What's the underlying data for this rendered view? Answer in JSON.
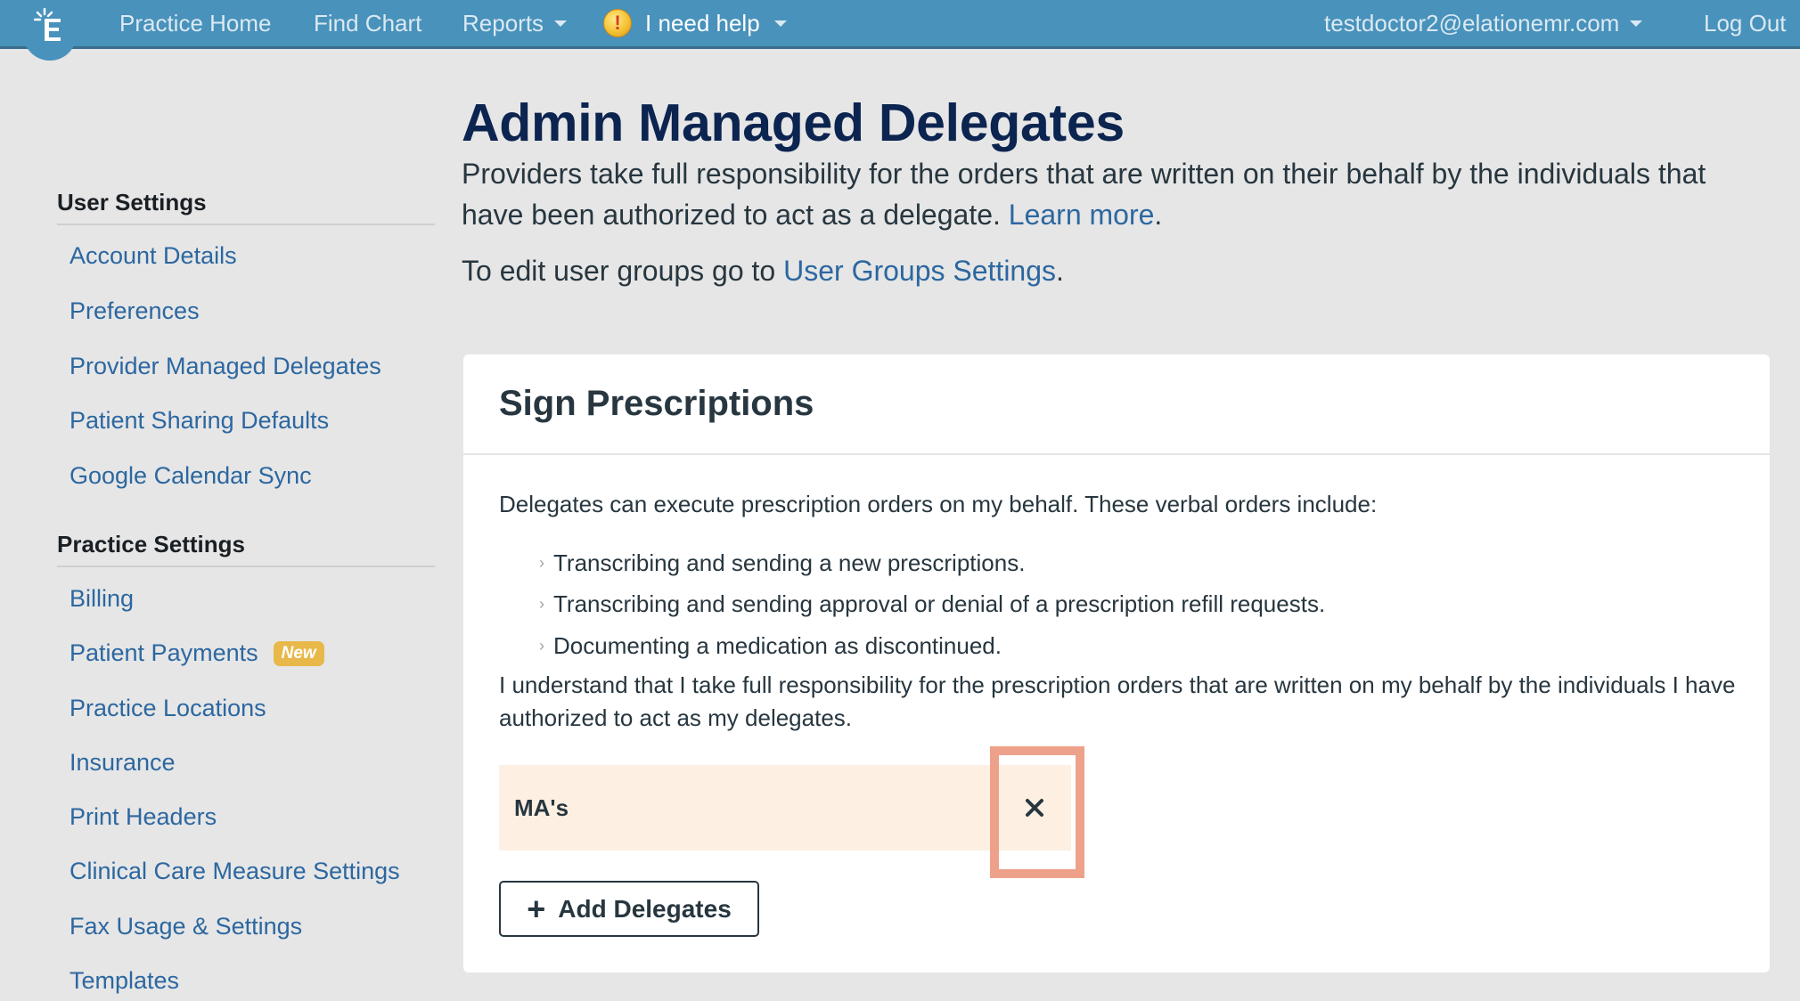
{
  "navbar": {
    "logo_icon": "elation-logo-icon",
    "items": [
      {
        "label": "Practice Home"
      },
      {
        "label": "Find Chart"
      },
      {
        "label": "Reports",
        "has_dropdown": true
      }
    ],
    "help": {
      "icon": "warning-exclamation-icon",
      "label": "I need help",
      "has_dropdown": true
    },
    "user_email": "testdoctor2@elationemr.com",
    "logout_label": "Log Out"
  },
  "sidebar": {
    "user_settings": {
      "heading": "User Settings",
      "items": [
        {
          "label": "Account Details"
        },
        {
          "label": "Preferences"
        },
        {
          "label": "Provider Managed Delegates"
        },
        {
          "label": "Patient Sharing Defaults"
        },
        {
          "label": "Google Calendar Sync"
        }
      ]
    },
    "practice_settings": {
      "heading": "Practice Settings",
      "items": [
        {
          "label": "Billing"
        },
        {
          "label": "Patient Payments",
          "badge": "New"
        },
        {
          "label": "Practice Locations"
        },
        {
          "label": "Insurance"
        },
        {
          "label": "Print Headers"
        },
        {
          "label": "Clinical Care Measure Settings"
        },
        {
          "label": "Fax Usage & Settings"
        },
        {
          "label": "Templates"
        }
      ]
    }
  },
  "main": {
    "title": "Admin Managed Delegates",
    "intro_text": "Providers take full responsibility for the orders that are written on their behalf by the individuals that have been authorized to act as a delegate.",
    "learn_more_label": "Learn more",
    "intro2_prefix": "To edit user groups go to",
    "user_groups_link": "User Groups Settings",
    "period": ".",
    "card": {
      "title": "Sign Prescriptions",
      "description": "Delegates can execute prescription orders on my behalf. These verbal orders include:",
      "bullets": [
        "Transcribing and sending a new prescriptions.",
        "Transcribing and sending approval or denial of a prescription refill requests.",
        "Documenting a medication as discontinued."
      ],
      "acknowledgement": "I understand that I take full responsibility for the prescription orders that are written on my behalf by the individuals I have authorized to act as my delegates.",
      "delegates": [
        {
          "name": "MA's",
          "remove_icon": "close-icon"
        }
      ],
      "add_button_label": "Add Delegates"
    }
  },
  "colors": {
    "navbar": "#4892bb",
    "link": "#2c67a0",
    "title": "#0c2450",
    "badge_new": "#e8b84a",
    "delegate_row_bg": "#fdf0e3",
    "highlight": "#eea18a"
  }
}
